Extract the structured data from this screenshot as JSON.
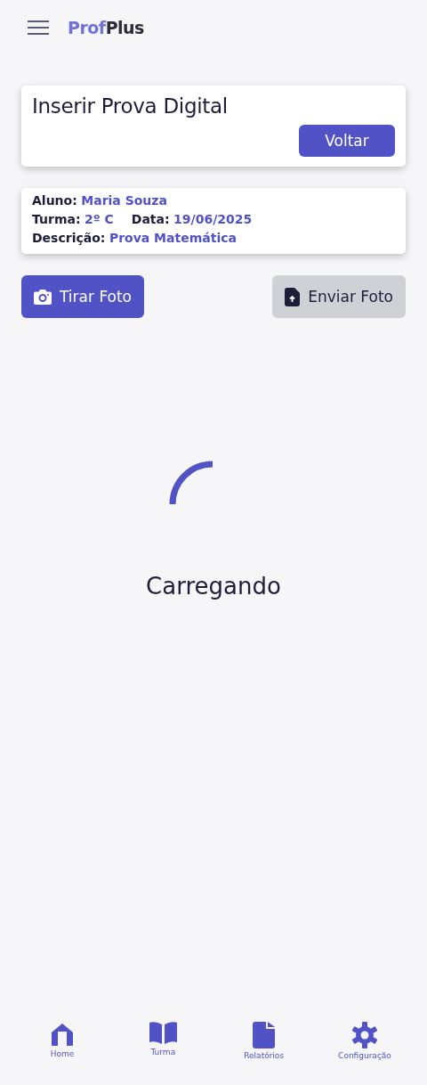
{
  "header": {
    "logo_first": "Prof",
    "logo_second": "Plus"
  },
  "title_card": {
    "title": "Inserir Prova Digital",
    "button": "Voltar"
  },
  "info": {
    "rows": [
      [
        {
          "label": "Aluno:",
          "value": "Maria Souza"
        }
      ],
      [
        {
          "label": "Turma:",
          "value": "2º C"
        },
        {
          "label": "Data:",
          "value": "19/06/2025"
        }
      ],
      [
        {
          "label": "Descrição:",
          "value": "Prova Matemática"
        }
      ]
    ]
  },
  "actions": [
    {
      "kind": "camera",
      "label": "Tirar Foto"
    },
    {
      "kind": "upload",
      "label": "Enviar Foto"
    }
  ],
  "loading": {
    "label": "Carregando"
  },
  "nav": [
    {
      "kind": "home",
      "label": "Home"
    },
    {
      "kind": "book",
      "label": "Turma"
    },
    {
      "kind": "file",
      "label": "Relatórios"
    },
    {
      "kind": "gear",
      "label": "Configuração"
    }
  ]
}
